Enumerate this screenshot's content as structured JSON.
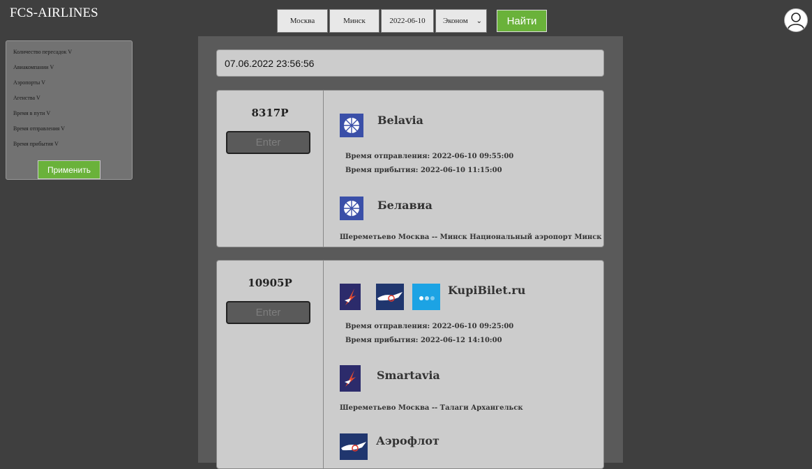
{
  "app": {
    "title": "FCS-AIRLINES"
  },
  "search": {
    "from": "Москва",
    "to": "Минск",
    "date": "2022-06-10",
    "class": "Эконом",
    "find_label": "Найти"
  },
  "filters": {
    "items": [
      "Количество пересадок V",
      "Авиакомпании V",
      "Аэропорты V",
      "Агенства V",
      "Время в пути V",
      "Время отправления V",
      "Время прибытия V"
    ],
    "apply_label": "Применить"
  },
  "timestamp": "07.06.2022 23:56:56",
  "results": [
    {
      "price": "8317Р",
      "enter_label": "Enter",
      "agent_name": "Belavia",
      "departure": "Время отправления: 2022-06-10 09:55:00",
      "arrival": "Время прибытия: 2022-06-10 11:15:00",
      "airline_name": "Белавиа",
      "route": "Шереметьево Москва -- Минск Национальный аэропорт Минск"
    },
    {
      "price": "10905Р",
      "enter_label": "Enter",
      "agent_name": "KupiBilet.ru",
      "departure": "Время отправления: 2022-06-10 09:25:00",
      "arrival": "Время прибытия: 2022-06-12 14:10:00",
      "airline_name": "Smartavia",
      "route": "Шереметьево Москва -- Талаги Архангельск",
      "airline_name_2": "Аэрофлот"
    }
  ],
  "icons": {
    "belavia": "belavia-logo-icon",
    "smartavia": "smartavia-logo-icon",
    "aeroflot": "aeroflot-logo-icon",
    "kupibilet": "kupibilet-logo-icon"
  },
  "colors": {
    "accent_green": "#6ab23a",
    "background": "#3f3f3f",
    "card": "#cccccc"
  }
}
